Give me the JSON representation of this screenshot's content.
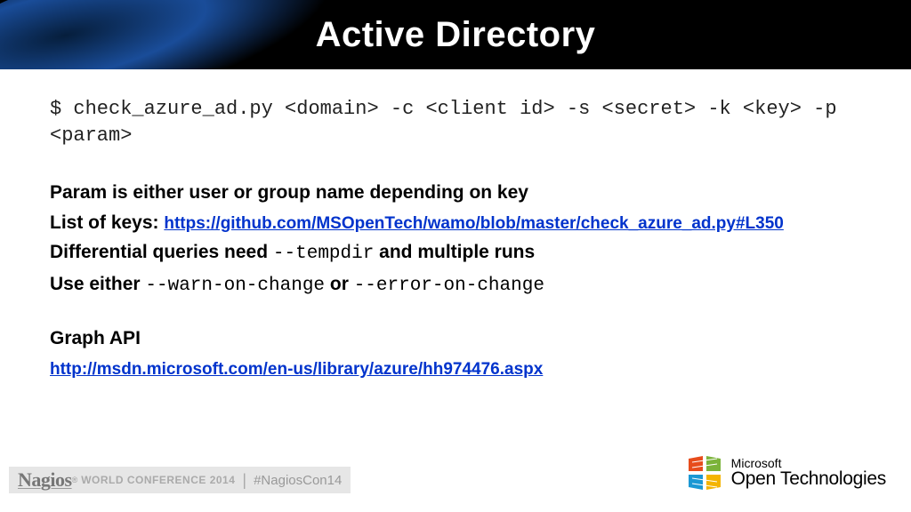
{
  "header": {
    "title": "Active Directory"
  },
  "command": "$ check_azure_ad.py <domain> -c <client id> -s <secret> -k <key> -p <param>",
  "lines": {
    "param_desc": "Param is either user or group name depending on key",
    "list_label": "List of keys: ",
    "list_url": "https://github.com/MSOpenTech/wamo/blob/master/check_azure_ad.py#L350",
    "diff_pre": "Differential queries need ",
    "diff_flag": "--tempdir",
    "diff_post": "  and multiple runs",
    "use_pre": "Use either ",
    "use_flag1": "--warn-on-change",
    "use_mid": "  or ",
    "use_flag2": "--error-on-change",
    "graph_heading": "Graph API",
    "graph_url": "http://msdn.microsoft.com/en-us/library/azure/hh974476.aspx"
  },
  "footer": {
    "brand": "Nagios",
    "reg": "®",
    "conf": "WORLD CONFERENCE 2014",
    "hashtag": "#NagiosCon14",
    "ms1": "Microsoft",
    "ms2": "Open Technologies"
  }
}
